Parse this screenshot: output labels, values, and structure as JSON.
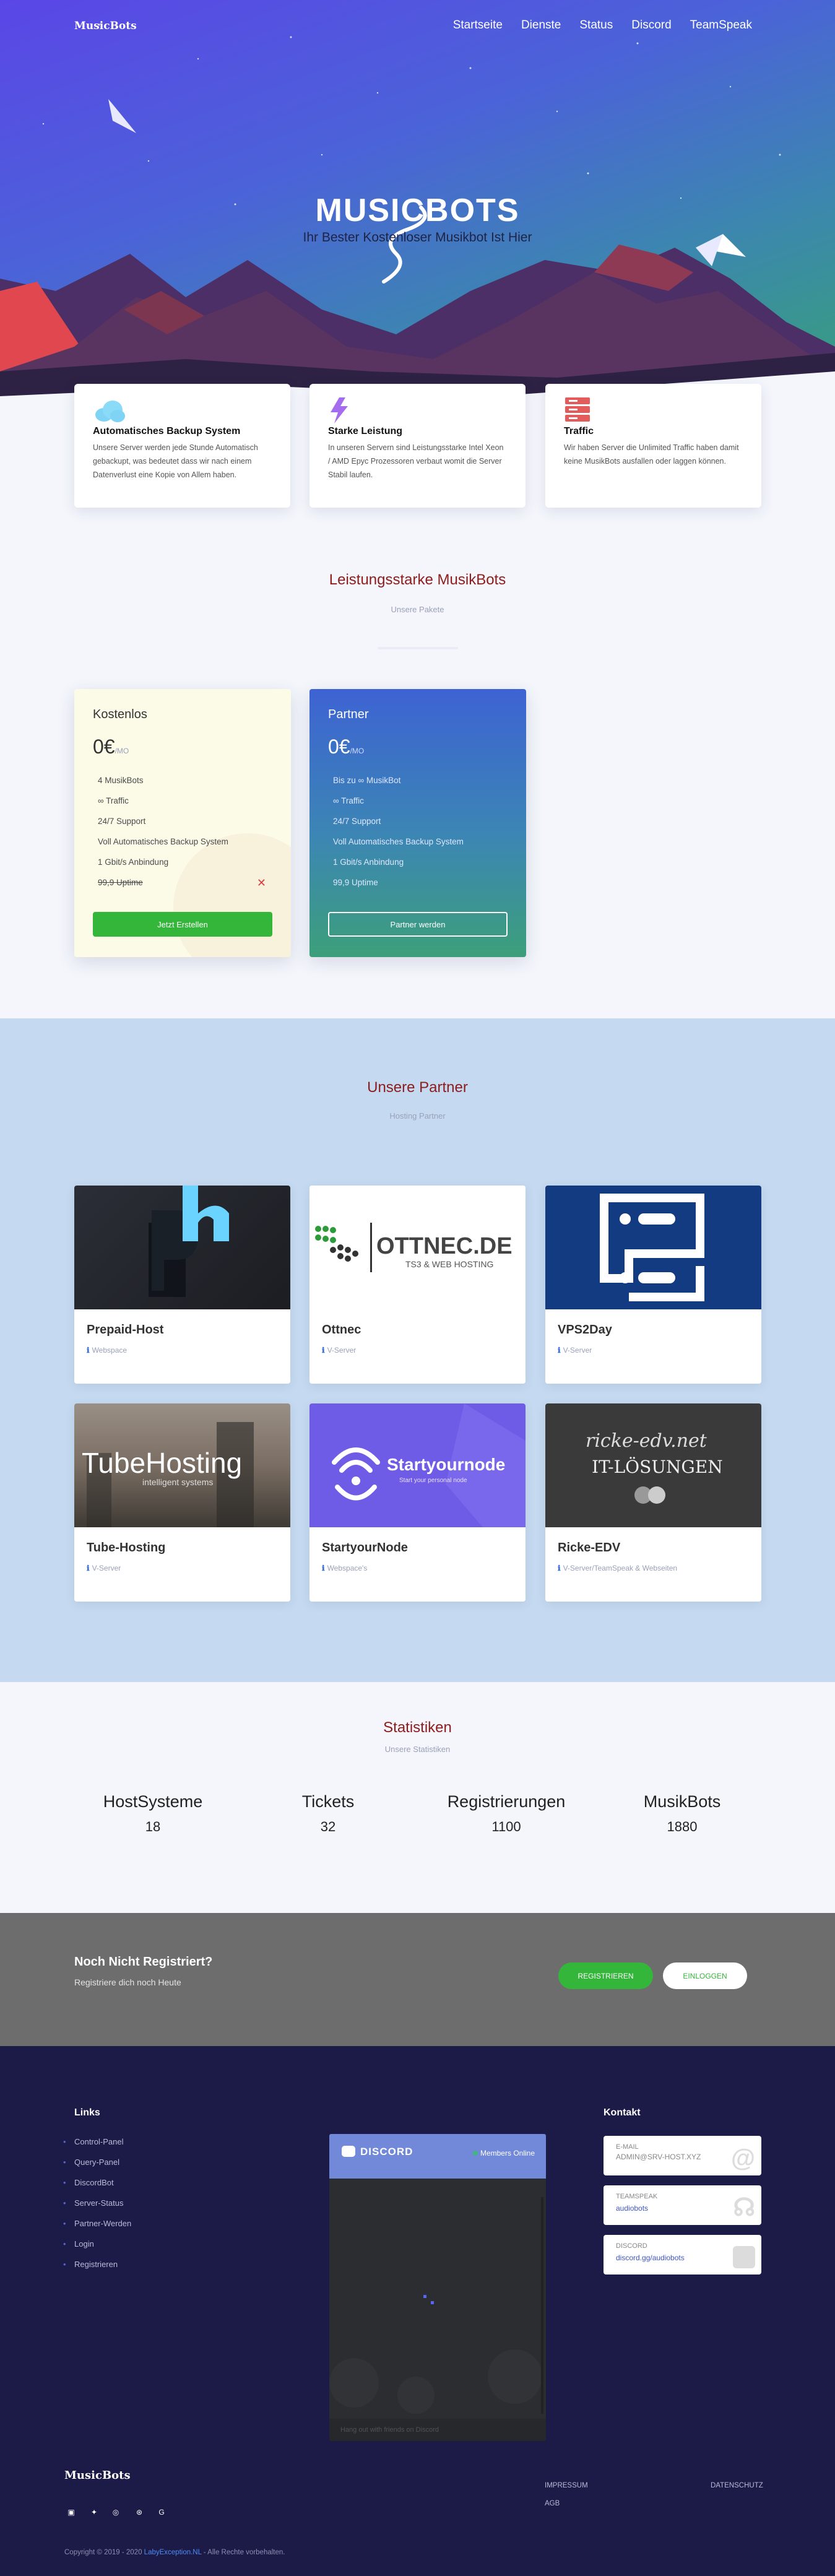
{
  "nav": {
    "logo": "MusicBots",
    "items": [
      "Startseite",
      "Dienste",
      "Status",
      "Discord",
      "TeamSpeak"
    ]
  },
  "hero": {
    "title": "MUSICBOTS",
    "subtitle": "Ihr Bester Kostenloser Musikbot Ist Hier"
  },
  "features": [
    {
      "icon": "cloud-icon",
      "title": "Automatisches Backup System",
      "text": "Unsere Server werden jede Stunde Automatisch gebackupt, was bedeutet dass wir nach einem Datenverlust eine Kopie von Allem haben."
    },
    {
      "icon": "lightning-icon",
      "title": "Starke Leistung",
      "text": "In unseren Servern sind Leistungsstarke Intel Xeon / AMD Epyc Prozessoren verbaut womit die Server Stabil laufen."
    },
    {
      "icon": "server-icon",
      "title": "Traffic",
      "text": "Wir haben Server die Unlimited Traffic haben damit keine MusikBots ausfallen oder laggen können."
    }
  ],
  "packages": {
    "title": "Leistungsstarke MusikBots",
    "subtitle": "Unsere Pakete",
    "free": {
      "name": "Kostenlos",
      "price": "0€",
      "per": "/MO",
      "features": [
        "4 MusikBots",
        "∞ Traffic",
        "24/7 Support",
        "Voll Automatisches Backup System",
        "1 Gbit/s Anbindung",
        "99,9 Uptime"
      ],
      "button": "Jetzt Erstellen"
    },
    "partner": {
      "name": "Partner",
      "price": "0€",
      "per": "/MO",
      "features": [
        "Bis zu ∞ MusikBot",
        "∞ Traffic",
        "24/7 Support",
        "Voll Automatisches Backup System",
        "1 Gbit/s Anbindung",
        "99,9 Uptime"
      ],
      "button": "Partner werden"
    }
  },
  "partners": {
    "title": "Unsere Partner",
    "subtitle": "Hosting Partner",
    "items": [
      {
        "name": "Prepaid-Host",
        "tag": "Webspace",
        "logo": "ph"
      },
      {
        "name": "Ottnec",
        "tag": "V-Server",
        "logo": "OTTNEC.DE",
        "logo_sub": "TS3 & WEB HOSTING"
      },
      {
        "name": "VPS2Day",
        "tag": "V-Server",
        "logo": ""
      },
      {
        "name": "Tube-Hosting",
        "tag": "V-Server",
        "logo": "TubeHosting",
        "logo_sub": "intelligent systems"
      },
      {
        "name": "StartyourNode",
        "tag": "Webspace's",
        "logo": "Startyournode",
        "logo_sub": "Start your personal node"
      },
      {
        "name": "Ricke-EDV",
        "tag": "V-Server/TeamSpeak & Webseiten",
        "logo": "ricke-edv.net",
        "logo_sub": "IT-LÖSUNGEN"
      }
    ]
  },
  "stats": {
    "title": "Statistiken",
    "subtitle": "Unsere Statistiken",
    "items": [
      {
        "label": "HostSysteme",
        "value": "18"
      },
      {
        "label": "Tickets",
        "value": "32"
      },
      {
        "label": "Registrierungen",
        "value": "1100"
      },
      {
        "label": "MusikBots",
        "value": "1880"
      }
    ]
  },
  "cta": {
    "title": "Noch Nicht Registriert?",
    "subtitle": "Registriere dich noch Heute",
    "register": "REGISTRIEREN",
    "login": "EINLOGGEN"
  },
  "footer": {
    "links_title": "Links",
    "links": [
      "Control-Panel",
      "Query-Panel",
      "DiscordBot",
      "Server-Status",
      "Partner-Werden",
      "Login",
      "Registrieren"
    ],
    "discord": {
      "logo": "DISCORD",
      "online": "Members Online",
      "footer": "Hang out with friends on Discord"
    },
    "contact_title": "Kontakt",
    "contacts": [
      {
        "label": "E-MAIL",
        "value": "ADMIN@SRV-HOST.XYZ",
        "icon": "at-icon"
      },
      {
        "label": "TEAMSPEAK",
        "value": "audiobots",
        "icon": "headset-icon"
      },
      {
        "label": "DISCORD",
        "value": "discord.gg/audiobots",
        "icon": "discord-icon"
      }
    ],
    "logo": "MusicBots",
    "legal": {
      "impressum": "IMPRESSUM",
      "agb": "AGB",
      "datenschutz": "DATENSCHUTZ"
    },
    "copyright_pre": "Copyright © 2019 - 2020 ",
    "copyright_link": "LabyException.NL",
    "copyright_post": " - Alle Rechte vorbehalten."
  }
}
